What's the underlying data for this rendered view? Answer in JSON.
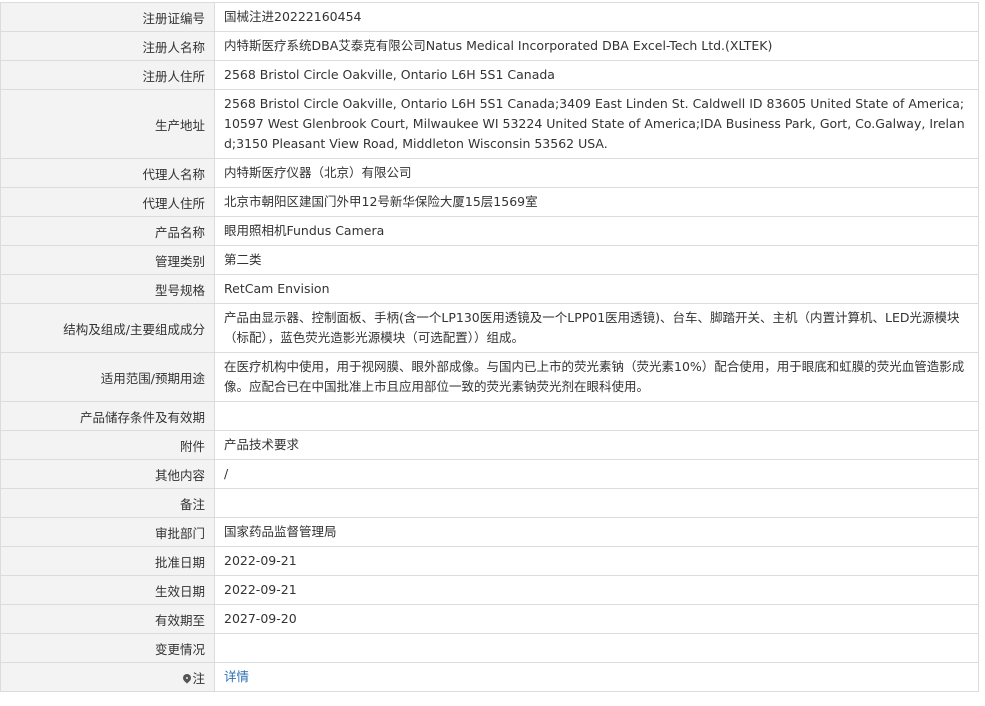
{
  "rows": [
    {
      "label": "注册证编号",
      "value": "国械注进20222160454"
    },
    {
      "label": "注册人名称",
      "value": "内特斯医疗系统DBA艾泰克有限公司Natus Medical Incorporated DBA Excel-Tech Ltd.(XLTEK)"
    },
    {
      "label": "注册人住所",
      "value": "2568 Bristol Circle Oakville, Ontario L6H 5S1 Canada"
    },
    {
      "label": "生产地址",
      "value": "2568 Bristol Circle Oakville, Ontario L6H 5S1 Canada;3409 East Linden St. Caldwell ID 83605 United State of America;10597 West Glenbrook Court, Milwaukee WI 53224 United State of America;IDA Business Park, Gort, Co.Galway, Ireland;3150 Pleasant View Road, Middleton Wisconsin 53562 USA."
    },
    {
      "label": "代理人名称",
      "value": "内特斯医疗仪器（北京）有限公司"
    },
    {
      "label": "代理人住所",
      "value": "北京市朝阳区建国门外甲12号新华保险大厦15层1569室"
    },
    {
      "label": "产品名称",
      "value": "眼用照相机Fundus Camera"
    },
    {
      "label": "管理类别",
      "value": "第二类"
    },
    {
      "label": "型号规格",
      "value": "RetCam Envision"
    },
    {
      "label": "结构及组成/主要组成成分",
      "value": "产品由显示器、控制面板、手柄(含一个LP130医用透镜及一个LPP01医用透镜)、台车、脚踏开关、主机（内置计算机、LED光源模块（标配），蓝色荧光造影光源模块（可选配置））组成。"
    },
    {
      "label": "适用范围/预期用途",
      "value": "在医疗机构中使用，用于视网膜、眼外部成像。与国内已上市的荧光素钠（荧光素10%）配合使用，用于眼底和虹膜的荧光血管造影成像。应配合已在中国批准上市且应用部位一致的荧光素钠荧光剂在眼科使用。"
    },
    {
      "label": "产品储存条件及有效期",
      "value": ""
    },
    {
      "label": "附件",
      "value": "产品技术要求"
    },
    {
      "label": "其他内容",
      "value": "/"
    },
    {
      "label": "备注",
      "value": ""
    },
    {
      "label": "审批部门",
      "value": "国家药品监督管理局"
    },
    {
      "label": "批准日期",
      "value": "2022-09-21"
    },
    {
      "label": "生效日期",
      "value": "2022-09-21"
    },
    {
      "label": "有效期至",
      "value": "2027-09-20"
    },
    {
      "label": "变更情况",
      "value": ""
    }
  ],
  "note": {
    "label": "注",
    "link_text": "详情",
    "icon": "location-pin-icon",
    "link_color": "#2a6fb3"
  }
}
